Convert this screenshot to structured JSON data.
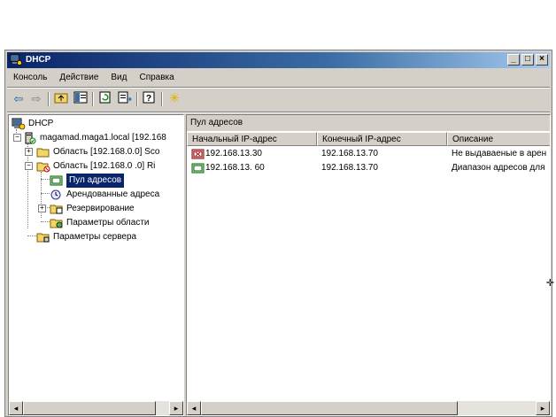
{
  "window": {
    "title": "DHCP",
    "caption_buttons": [
      "_",
      "□",
      "×"
    ]
  },
  "menu": [
    "Консоль",
    "Действие",
    "Вид",
    "Справка"
  ],
  "toolbar": {
    "buttons": [
      "back-icon",
      "forward-icon",
      "up-folder-icon",
      "show-hide-tree-icon",
      "refresh-icon",
      "export-list-icon",
      "help-icon",
      "new-item-icon"
    ]
  },
  "tree": {
    "root": "DHCP",
    "server": "magamad.maga1.local [192.168",
    "scope1": "Область [192.168.0.0] Sco",
    "scope2": "Область [192.168.0 .0] Ri",
    "address_pool": "Пул адресов",
    "leases": "Арендованные адреса",
    "reservations": "Резервирование",
    "scope_options": "Параметры области",
    "server_options": "Параметры сервера"
  },
  "right_pane": {
    "title": "Пул адресов",
    "columns": [
      "Начальный IP-адрес",
      "Конечный IP-адрес",
      "Описание"
    ],
    "rows": [
      {
        "start": "192.168.13.30",
        "end": "192.168.13.70",
        "description": "Не выдаваеные в арен"
      },
      {
        "start": "192.168.13. 60",
        "end": "192.168.13.70",
        "description": "Диапазон адресов для"
      }
    ]
  },
  "colors": {
    "titlebar_start": "#0a246a",
    "titlebar_end": "#a6caf0",
    "selection": "#0a246a",
    "face": "#d4d0c8"
  }
}
